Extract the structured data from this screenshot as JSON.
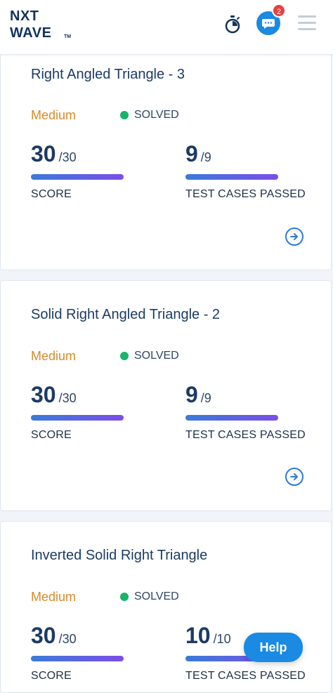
{
  "header": {
    "logo_line1": "NXT",
    "logo_line2": "WAVE",
    "logo_tm": "TM",
    "notification_count": "2"
  },
  "problems": [
    {
      "title": "Right Angled Triangle - 3",
      "difficulty": "Medium",
      "status": "SOLVED",
      "score": "30",
      "score_total": "/30",
      "score_label": "SCORE",
      "tests": "9",
      "tests_total": "/9",
      "tests_label": "TEST CASES PASSED"
    },
    {
      "title": "Solid Right Angled Triangle - 2",
      "difficulty": "Medium",
      "status": "SOLVED",
      "score": "30",
      "score_total": "/30",
      "score_label": "SCORE",
      "tests": "9",
      "tests_total": "/9",
      "tests_label": "TEST CASES PASSED"
    },
    {
      "title": "Inverted Solid Right Triangle",
      "difficulty": "Medium",
      "status": "SOLVED",
      "score": "30",
      "score_total": "/30",
      "score_label": "SCORE",
      "tests": "10",
      "tests_total": "/10",
      "tests_label": "TEST CASES PASSED"
    }
  ],
  "help_label": "Help",
  "colors": {
    "brand": "#12325c",
    "accent_blue": "#1a8ae3",
    "difficulty_medium": "#d88a2b",
    "solved_green": "#18b46a",
    "badge_red": "#e5413e",
    "bar_start": "#3a7bd8",
    "bar_end": "#7b4ee8"
  },
  "icons": {
    "timer": "stopwatch-icon",
    "chat": "chat-bubble-icon",
    "menu": "hamburger-menu-icon",
    "open": "arrow-right-circle-icon"
  }
}
